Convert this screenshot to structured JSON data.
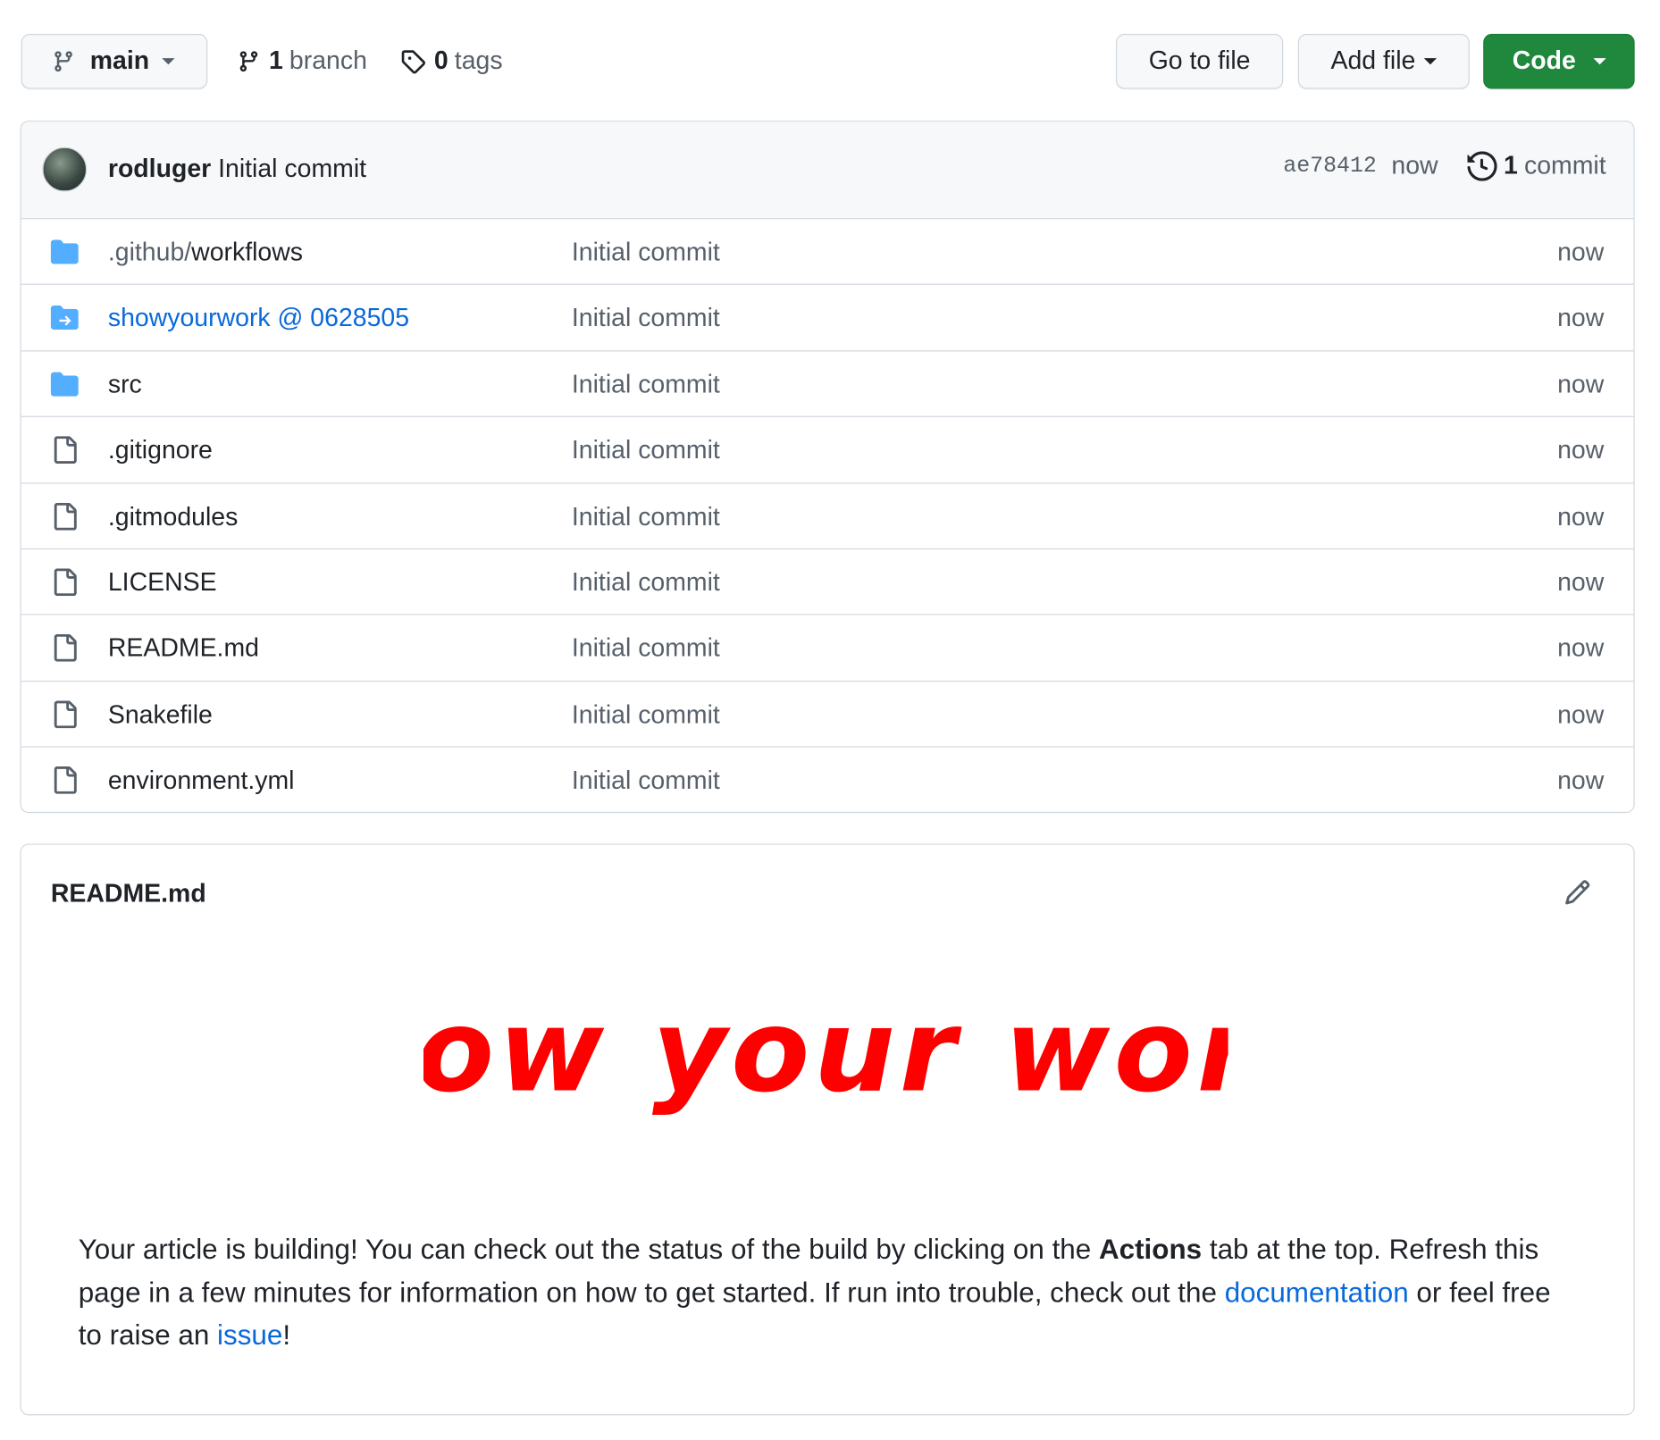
{
  "toolbar": {
    "branch": "main",
    "branches_count": "1",
    "branches_label": "branch",
    "tags_count": "0",
    "tags_label": "tags",
    "goto_file": "Go to file",
    "add_file": "Add file",
    "code": "Code"
  },
  "latest_commit": {
    "author": "rodluger",
    "message": "Initial commit",
    "sha": "ae78412",
    "time": "now",
    "count": "1",
    "count_label": "commit"
  },
  "files": [
    {
      "type": "folder",
      "name_prefix": ".github/",
      "name": "workflows",
      "message": "Initial commit",
      "time": "now"
    },
    {
      "type": "submodule",
      "name_prefix": "",
      "name": "showyourwork @ 0628505",
      "message": "Initial commit",
      "time": "now"
    },
    {
      "type": "folder",
      "name_prefix": "",
      "name": "src",
      "message": "Initial commit",
      "time": "now"
    },
    {
      "type": "file",
      "name_prefix": "",
      "name": ".gitignore",
      "message": "Initial commit",
      "time": "now"
    },
    {
      "type": "file",
      "name_prefix": "",
      "name": ".gitmodules",
      "message": "Initial commit",
      "time": "now"
    },
    {
      "type": "file",
      "name_prefix": "",
      "name": "LICENSE",
      "message": "Initial commit",
      "time": "now"
    },
    {
      "type": "file",
      "name_prefix": "",
      "name": "README.md",
      "message": "Initial commit",
      "time": "now"
    },
    {
      "type": "file",
      "name_prefix": "",
      "name": "Snakefile",
      "message": "Initial commit",
      "time": "now"
    },
    {
      "type": "file",
      "name_prefix": "",
      "name": "environment.yml",
      "message": "Initial commit",
      "time": "now"
    }
  ],
  "readme": {
    "title": "README.md",
    "logo_text": "show your work!",
    "text_1": "Your article is building! You can check out the status of the build by clicking on the ",
    "text_bold": "Actions",
    "text_2": " tab at the top. Refresh this page in a few minutes for information on how to get started. If run into trouble, check out the ",
    "link_docs": "documentation",
    "text_3": " or feel free to raise an ",
    "link_issue": "issue",
    "text_4": "!"
  },
  "colors": {
    "accent_link": "#0969da",
    "code_button": "#1f883d",
    "folder_icon": "#54aeff",
    "logo_red": "#ff0000"
  }
}
